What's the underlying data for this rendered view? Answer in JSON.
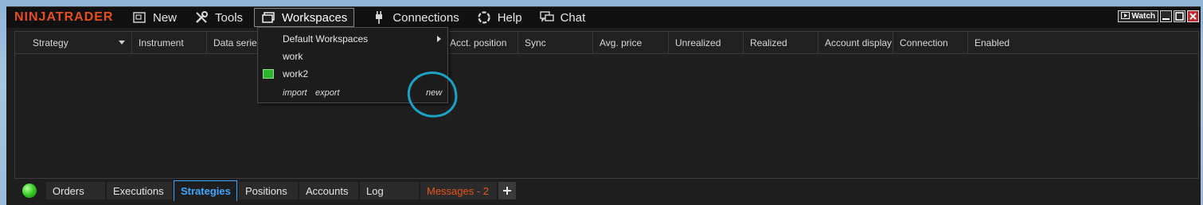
{
  "app": {
    "logo_text": "NINJATRADER"
  },
  "menu": [
    {
      "label": "New",
      "icon": "new-window-icon"
    },
    {
      "label": "Tools",
      "icon": "tools-icon"
    },
    {
      "label": "Workspaces",
      "icon": "workspaces-icon",
      "active": true
    },
    {
      "label": "Connections",
      "icon": "plug-icon"
    },
    {
      "label": "Help",
      "icon": "help-lifebuoy-icon"
    },
    {
      "label": "Chat",
      "icon": "chat-icon"
    }
  ],
  "window_controls": {
    "watch_label": "Watch"
  },
  "grid": {
    "columns": [
      "Strategy",
      "Instrument",
      "Data series",
      "Acct. position",
      "Sync",
      "Avg. price",
      "Unrealized",
      "Realized",
      "Account display",
      "Connection",
      "Enabled"
    ]
  },
  "workspaces_menu": {
    "items": [
      {
        "label": "Default Workspaces",
        "has_submenu": true
      },
      {
        "label": "work"
      },
      {
        "label": "work2",
        "selected": true
      }
    ],
    "footer": {
      "import": "import",
      "export": "export",
      "new": "new"
    }
  },
  "tabs": [
    {
      "label": "Orders"
    },
    {
      "label": "Executions"
    },
    {
      "label": "Strategies",
      "active": true
    },
    {
      "label": "Positions"
    },
    {
      "label": "Accounts"
    },
    {
      "label": "Log"
    },
    {
      "label": "Messages - 2"
    }
  ],
  "colors": {
    "brand": "#e84d1c",
    "active_tab": "#3ea6ff",
    "annotation": "#1aa3c4",
    "connected": "#3ed12a"
  }
}
